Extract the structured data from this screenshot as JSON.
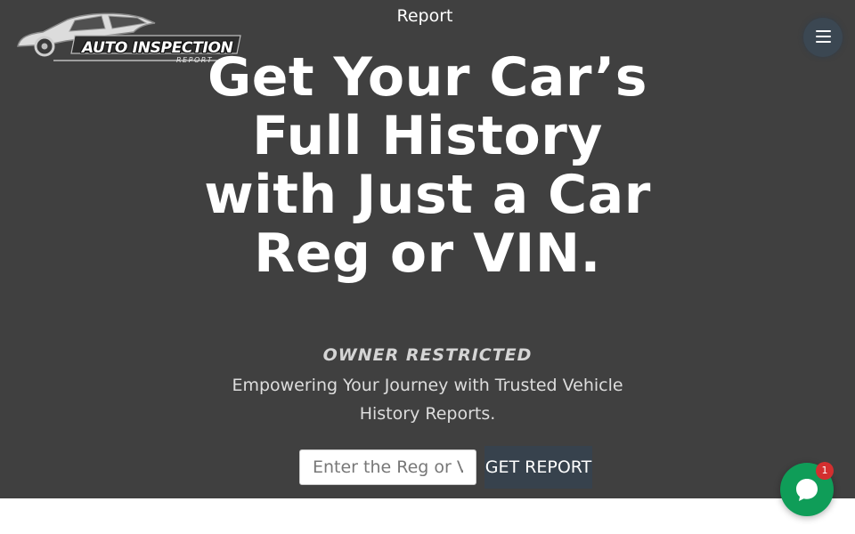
{
  "brand": {
    "logo_text": "AUTO INSPECTION",
    "logo_subtext": "REPORT"
  },
  "nav": {
    "report_label": "Report",
    "menu_icon": "hamburger-menu-icon"
  },
  "hero": {
    "headline": "Get Your Car’s Full History with Just a Car Reg or VIN.",
    "tagline": "OWNER RESTRICTED",
    "subtitle": "Empowering Your Journey with Trusted Vehicle History Reports."
  },
  "search": {
    "placeholder": "Enter the Reg or VIN",
    "value": "",
    "button_label": "GET REPORT"
  },
  "chat": {
    "icon": "chat-bubble-icon",
    "badge_count": "1"
  },
  "colors": {
    "hero_background": "#404040",
    "button_background": "#37424d",
    "chat_green": "#0f9d58",
    "badge_red": "#d32f2f"
  }
}
